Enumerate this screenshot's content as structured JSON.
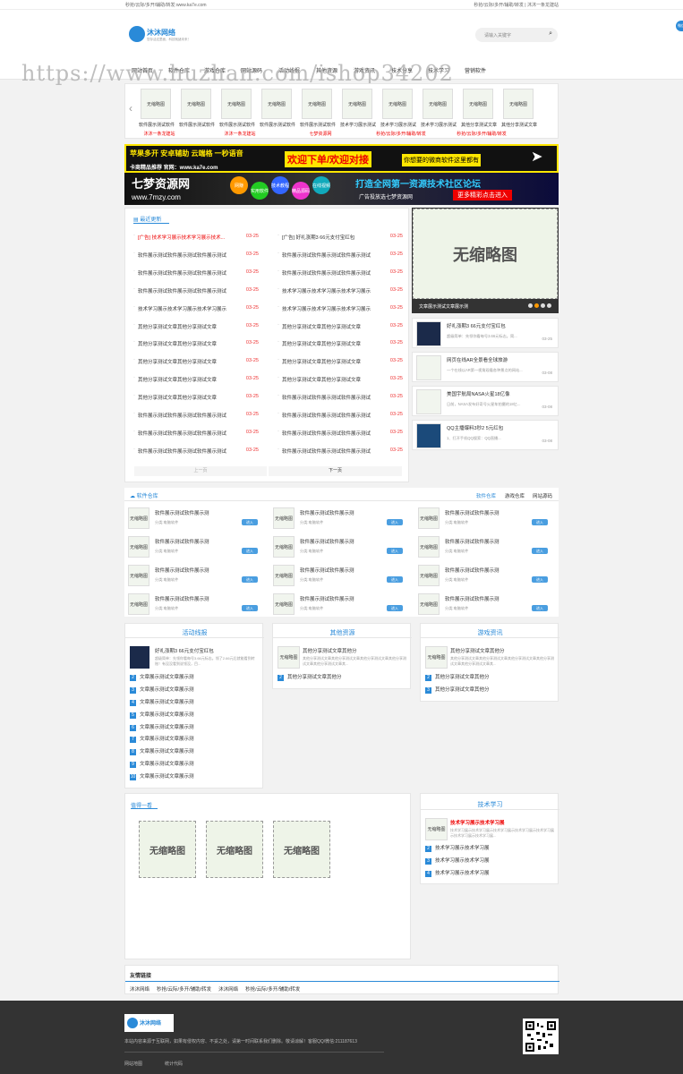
{
  "topbar": {
    "left": "秒抢/云际/多开/辅助/转发:www.ka7e.com",
    "right": "秒抢/云际/多开/辅助/转发 | 沐沐一条龙建站"
  },
  "header": {
    "logo": "沐沐网络",
    "slogan": "您存活这里面，科技就绪未来！",
    "search_placeholder": "请输入关键字",
    "side_icon": "微信"
  },
  "nav": [
    "网站首页",
    "软件仓库",
    "游戏仓库",
    "网站源码",
    "活动线报",
    "其他资源",
    "游戏资讯",
    "技术分享",
    "技术学习",
    "营销软件"
  ],
  "watermark": "https://www.huzhan.com/ishop34202",
  "carousel": {
    "items": [
      {
        "img": "无缩略图",
        "title": "软件展示测试软件",
        "tag": "沐沐一条龙建站"
      },
      {
        "img": "无缩略图",
        "title": "软件展示测试软件",
        "tag": ""
      },
      {
        "img": "无缩略图",
        "title": "软件展示测试软件",
        "tag": "沐沐一条龙建站"
      },
      {
        "img": "无缩略图",
        "title": "软件展示测试软件",
        "tag": ""
      },
      {
        "img": "无缩略图",
        "title": "软件展示测试软件",
        "tag": "七梦资源网"
      },
      {
        "img": "无缩略图",
        "title": "技术学习展示测试",
        "tag": ""
      },
      {
        "img": "无缩略图",
        "title": "技术学习展示测试",
        "tag": "秒抢/云际/多开/辅助/转发"
      },
      {
        "img": "无缩略图",
        "title": "技术学习展示测试",
        "tag": ""
      },
      {
        "img": "无缩略图",
        "title": "其他分享测试文章",
        "tag": "秒抢/云际/多开/辅助/转发"
      },
      {
        "img": "无缩略图",
        "title": "其他分享测试文章",
        "tag": ""
      }
    ],
    "prev": "‹"
  },
  "banner1": {
    "line1": "苹果多开 安卓辅助 云端格 一秒语音",
    "sub": "卡商精品推荐 官网：www.ka7e.com",
    "center": "欢迎下单/欢迎对接",
    "right": "你想要的微商软件这里都有"
  },
  "banner2": {
    "title": "七梦资源网",
    "url": "www.7mzy.com",
    "bubbles": [
      "网赚",
      "实用软件",
      "技术教程",
      "精品源码",
      "在线视频"
    ],
    "slogan": "打造全网第一资源技术社区论坛",
    "sub": "广告投放选七梦资源网",
    "cta": "更多精彩点击进入"
  },
  "latest": {
    "title": "最近更新",
    "left": [
      {
        "text": "[广告] 技术学习展示技术学习展示技术...",
        "date": "03-25",
        "ad": true
      },
      {
        "text": "软件展示测试软件展示测试软件展示测试",
        "date": "03-25"
      },
      {
        "text": "软件展示测试软件展示测试软件展示测试",
        "date": "03-25"
      },
      {
        "text": "软件展示测试软件展示测试软件展示测试",
        "date": "03-25"
      },
      {
        "text": "技术学习展示技术学习展示技术学习展示",
        "date": "03-25"
      },
      {
        "text": "其他分享测试文章其他分享测试文章",
        "date": "03-25"
      },
      {
        "text": "其他分享测试文章其他分享测试文章",
        "date": "03-25"
      },
      {
        "text": "其他分享测试文章其他分享测试文章",
        "date": "03-25"
      },
      {
        "text": "其他分享测试文章其他分享测试文章",
        "date": "03-25"
      },
      {
        "text": "其他分享测试文章其他分享测试文章",
        "date": "03-25"
      },
      {
        "text": "软件展示测试软件展示测试软件展示测试",
        "date": "03-25"
      },
      {
        "text": "软件展示测试软件展示测试软件展示测试",
        "date": "03-25"
      },
      {
        "text": "软件展示测试软件展示测试软件展示测试",
        "date": "03-25"
      }
    ],
    "right": [
      {
        "text": "[广告] 好礼涨期3 66元支付宝红包",
        "date": "03-25"
      },
      {
        "text": "软件展示测试软件展示测试软件展示测试",
        "date": "03-25"
      },
      {
        "text": "软件展示测试软件展示测试软件展示测试",
        "date": "03-25"
      },
      {
        "text": "技术学习展示技术学习展示技术学习展示",
        "date": "03-25"
      },
      {
        "text": "技术学习展示技术学习展示技术学习展示",
        "date": "03-25"
      },
      {
        "text": "其他分享测试文章其他分享测试文章",
        "date": "03-25"
      },
      {
        "text": "其他分享测试文章其他分享测试文章",
        "date": "03-25"
      },
      {
        "text": "其他分享测试文章其他分享测试文章",
        "date": "03-25"
      },
      {
        "text": "其他分享测试文章其他分享测试文章",
        "date": "03-25"
      },
      {
        "text": "软件展示测试软件展示测试软件展示测试",
        "date": "03-25"
      },
      {
        "text": "软件展示测试软件展示测试软件展示测试",
        "date": "03-25"
      },
      {
        "text": "软件展示测试软件展示测试软件展示测试",
        "date": "03-25"
      },
      {
        "text": "软件展示测试软件展示测试软件展示测试",
        "date": "03-25"
      }
    ],
    "prev": "上一页",
    "next": "下一页"
  },
  "slide": {
    "img": "无缩略图",
    "caption": "文章展示测试文章展示测"
  },
  "side_news": [
    {
      "title": "好礼涨期3 66元支付宝红包",
      "desc": "超级简单：先领你看每号3.66元标志。简...",
      "date": "03-25"
    },
    {
      "title": "网页在线AR全景看全球旅游",
      "desc": "一个在线以AR第一视角观看各种景点的网站...",
      "date": "03-08"
    },
    {
      "title": "美国宇航局NASA火星18亿像",
      "desc": "日前，NASA发布好奇号火星车拍摄的18亿...",
      "date": "03-08"
    },
    {
      "title": "QQ主播爆料3秒2 5元红包",
      "desc": "1、打开手机QQ搜索：QQ直播...",
      "date": "03-08"
    }
  ],
  "software": {
    "title": "软件仓库",
    "tabs": [
      "软件仓库",
      "游戏仓库",
      "网站源码"
    ],
    "item_title": "软件展示测试软件展示测",
    "item_meta": "分类:电脑软件",
    "btn": "进入",
    "thumb": "无缩略图"
  },
  "boxes": [
    {
      "title": "活动线报",
      "top_title": "好礼涨期3 66元支付宝红包",
      "top_desc": "超级简单：先领你看每号3.66元标志。领了2.66元后就能看到转账！有没没看到说领没，目...",
      "items": [
        "文章展示测试文章展示测",
        "文章展示测试文章展示测",
        "文章展示测试文章展示测",
        "文章展示测试文章展示测",
        "文章展示测试文章展示测",
        "文章展示测试文章展示测",
        "文章展示测试文章展示测",
        "文章展示测试文章展示测",
        "文章展示测试文章展示测"
      ]
    },
    {
      "title": "其他资源",
      "top_title": "其他分享测试文章其他分",
      "top_desc": "其他分享测试文章其他分享测试文章其他分享测试文章其他分享测试文章其他分享测试文章其...",
      "thumb": "无缩略图",
      "items": [
        "其他分享测试文章其他分"
      ]
    },
    {
      "title": "游戏资讯",
      "top_title": "其他分享测试文章其他分",
      "top_desc": "其他分享测试文章其他分享测试文章其他分享测试文章其他分享测试文章其他分享测试文章其...",
      "thumb": "无缩略图",
      "items": [
        "其他分享测试文章其他分",
        "其他分享测试文章其他分"
      ]
    }
  ],
  "recommend": {
    "title": "值得一看",
    "img": "无缩略图"
  },
  "tech": {
    "title": "技术学习",
    "top_title": "技术学习展示技术学习展",
    "top_desc": "技术学习展示技术学习展示技术学习展示技术学习展示技术学习展示技术学习展示技术学习展...",
    "thumb": "无缩略图",
    "items": [
      "技术学习展示技术学习展",
      "技术学习展示技术学习展",
      "技术学习展示技术学习展"
    ]
  },
  "links": {
    "title": "友情链接",
    "items": [
      "沐沐网络",
      "秒抢/云际/多开/辅助/转发",
      "沐沐网络",
      "秒抢/云际/多开/辅助/转发"
    ]
  },
  "footer": {
    "logo": "沐沐网络",
    "text": "本站内容来源于互联网，如果有侵权内容、不妥之处，请第一时间联系我们删除。敬请谅解！客服QQ/微信:211187613",
    "links": [
      "网站地图",
      "统计代码"
    ]
  },
  "colors": {
    "accent": "#2a8ad8",
    "red": "#e00000",
    "footer": "#333333",
    "banner_yellow": "#ffe600"
  }
}
